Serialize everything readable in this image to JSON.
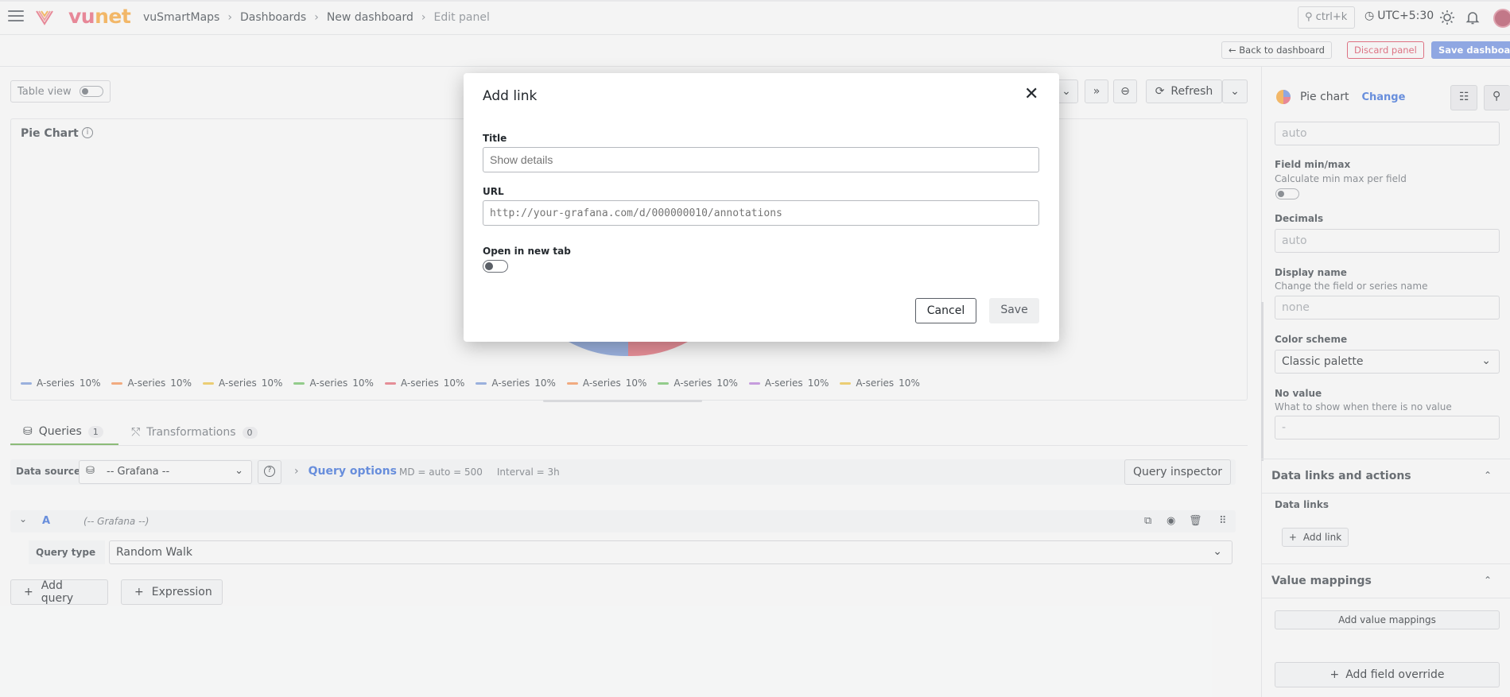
{
  "topbar": {
    "logo_vu": "vu",
    "logo_net": "net",
    "breadcrumbs": [
      "vuSmartMaps",
      "Dashboards",
      "New dashboard",
      "Edit panel"
    ],
    "search_shortcut": "ctrl+k",
    "timezone": "UTC+5:30"
  },
  "actions": {
    "back": "Back to dashboard",
    "discard": "Discard panel",
    "save": "Save dashboard"
  },
  "toolbar": {
    "table_view": "Table view",
    "refresh": "Refresh"
  },
  "panel": {
    "title": "Pie Chart",
    "legend": [
      {
        "label": "A-series",
        "value": "10%",
        "color": "#7c9ad6"
      },
      {
        "label": "A-series",
        "value": "10%",
        "color": "#f0935a"
      },
      {
        "label": "A-series",
        "value": "10%",
        "color": "#e9c14a"
      },
      {
        "label": "A-series",
        "value": "10%",
        "color": "#73bf69"
      },
      {
        "label": "A-series",
        "value": "10%",
        "color": "#e06c79"
      },
      {
        "label": "A-series",
        "value": "10%",
        "color": "#7c9ad6"
      },
      {
        "label": "A-series",
        "value": "10%",
        "color": "#f0935a"
      },
      {
        "label": "A-series",
        "value": "10%",
        "color": "#73bf69"
      },
      {
        "label": "A-series",
        "value": "10%",
        "color": "#b77fd6"
      },
      {
        "label": "A-series",
        "value": "10%",
        "color": "#e9c14a"
      }
    ]
  },
  "query_tabs": {
    "queries_label": "Queries",
    "queries_count": "1",
    "transformations_label": "Transformations",
    "transformations_count": "0"
  },
  "query_row": {
    "data_source_label": "Data source",
    "data_source_value": "-- Grafana --",
    "query_options": "Query options",
    "md": "MD = auto = 500",
    "interval": "Interval = 3h",
    "inspector": "Query inspector"
  },
  "query_a": {
    "letter": "A",
    "datasource": "(-- Grafana --)",
    "type_label": "Query type",
    "type_value": "Random Walk"
  },
  "add_buttons": {
    "add_query": "Add query",
    "expression": "Expression"
  },
  "options_pane": {
    "viz_name": "Pie chart",
    "viz_change": "Change",
    "auto_top": "auto",
    "field_minmax_label": "Field min/max",
    "field_minmax_desc": "Calculate min max per field",
    "decimals_label": "Decimals",
    "decimals_placeholder": "auto",
    "display_name_label": "Display name",
    "display_name_desc": "Change the field or series name",
    "display_name_placeholder": "none",
    "color_scheme_label": "Color scheme",
    "color_scheme_value": "Classic palette",
    "no_value_label": "No value",
    "no_value_desc": "What to show when there is no value",
    "no_value_placeholder": "-",
    "data_links_section": "Data links and actions",
    "data_links_label": "Data links",
    "add_link": "Add link",
    "value_mappings_section": "Value mappings",
    "add_value_mappings": "Add value mappings",
    "add_field_override": "Add field override"
  },
  "modal": {
    "title": "Add link",
    "title_label": "Title",
    "title_placeholder": "Show details",
    "url_label": "URL",
    "url_placeholder": "http://your-grafana.com/d/000000010/annotations",
    "new_tab_label": "Open in new tab",
    "cancel": "Cancel",
    "save": "Save"
  }
}
